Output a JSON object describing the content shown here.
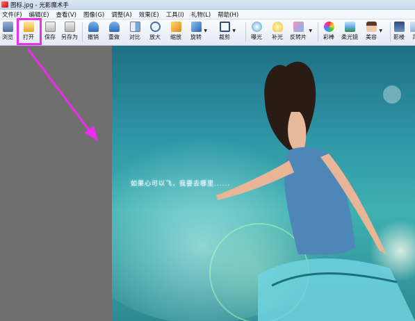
{
  "window": {
    "title": "图标.jpg - 光影魔术手"
  },
  "menu": [
    {
      "label": "文件(F)"
    },
    {
      "label": "编辑(E)"
    },
    {
      "label": "查看(V)"
    },
    {
      "label": "图像(G)"
    },
    {
      "label": "调整(A)"
    },
    {
      "label": "效果(E)"
    },
    {
      "label": "工具(I)"
    },
    {
      "label": "礼物(L)"
    },
    {
      "label": "帮助(H)"
    }
  ],
  "toolbar": {
    "buttons": [
      {
        "label": "浏览",
        "icon": "browse-icon"
      },
      {
        "label": "打开",
        "icon": "open-folder-icon"
      },
      {
        "label": "保存",
        "icon": "save-icon"
      },
      {
        "label": "另存为",
        "icon": "save-as-icon"
      },
      {
        "label": "撤销",
        "icon": "undo-icon"
      },
      {
        "label": "重做",
        "icon": "redo-icon"
      },
      {
        "label": "对比",
        "icon": "compare-icon"
      },
      {
        "label": "放大",
        "icon": "zoom-in-icon"
      },
      {
        "label": "缩放",
        "icon": "resize-icon"
      },
      {
        "label": "旋转",
        "icon": "rotate-icon"
      },
      {
        "label": "裁剪",
        "icon": "crop-icon"
      },
      {
        "label": "曝光",
        "icon": "exposure-icon"
      },
      {
        "label": "补光",
        "icon": "fill-light-icon"
      },
      {
        "label": "反转片",
        "icon": "reversal-film-icon"
      },
      {
        "label": "彩棒",
        "icon": "color-stick-icon"
      },
      {
        "label": "柔光镜",
        "icon": "soft-light-icon"
      },
      {
        "label": "美容",
        "icon": "beauty-icon"
      },
      {
        "label": "影楼",
        "icon": "studio-icon"
      },
      {
        "label": "风",
        "icon": "style-icon"
      }
    ]
  },
  "image": {
    "caption": "如果心可以飞，我要去哪里......"
  },
  "colors": {
    "highlight": "#ee2cf0",
    "workspace": "#6f6f6f"
  }
}
